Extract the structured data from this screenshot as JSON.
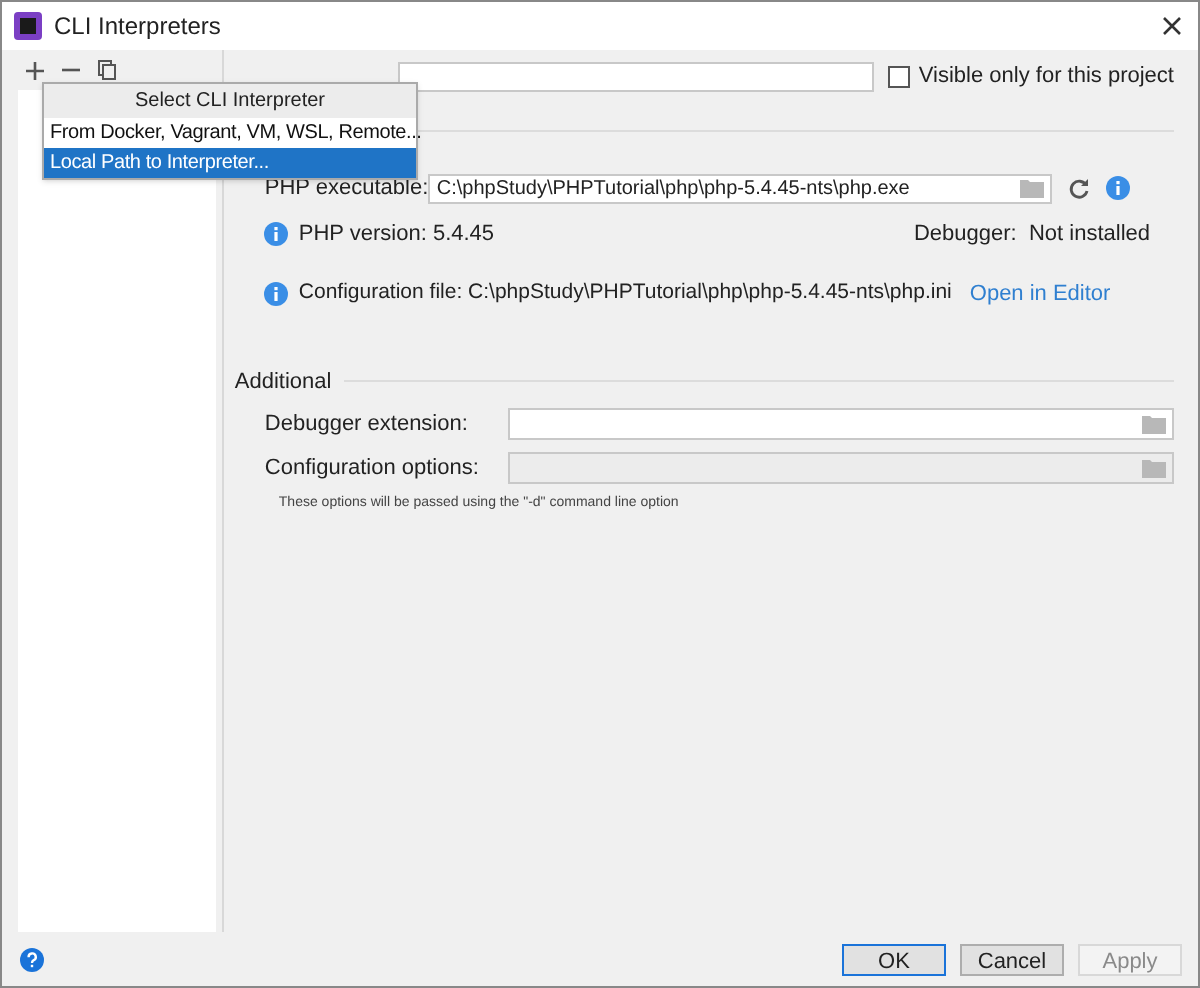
{
  "window": {
    "title": "CLI Interpreters"
  },
  "popup": {
    "title": "Select CLI Interpreter",
    "items": [
      {
        "label": "From Docker, Vagrant, VM, WSL, Remote...",
        "selected": false
      },
      {
        "label": "Local Path to Interpreter...",
        "selected": true
      }
    ]
  },
  "visible_only": {
    "label": "Visible only for this project",
    "checked": false
  },
  "php_executable": {
    "label": "PHP executable:",
    "value": "C:\\phpStudy\\PHPTutorial\\php\\php-5.4.45-nts\\php.exe"
  },
  "php_version": "PHP version: 5.4.45",
  "debugger": "Debugger:  Not installed",
  "config_file": {
    "text": "Configuration file: C:\\phpStudy\\PHPTutorial\\php\\php-5.4.45-nts\\php.ini",
    "link": "Open in Editor"
  },
  "additional": {
    "title": "Additional",
    "fields": [
      {
        "label": "Debugger extension:",
        "disabled": false
      },
      {
        "label": "Configuration options:",
        "disabled": true
      }
    ],
    "note": "These options will be passed using the \"-d\" command line option"
  },
  "buttons": [
    {
      "label": "OK",
      "kind": "default",
      "disabled": false
    },
    {
      "label": "Cancel",
      "kind": "normal",
      "disabled": false
    },
    {
      "label": "Apply",
      "kind": "normal",
      "disabled": true
    }
  ]
}
